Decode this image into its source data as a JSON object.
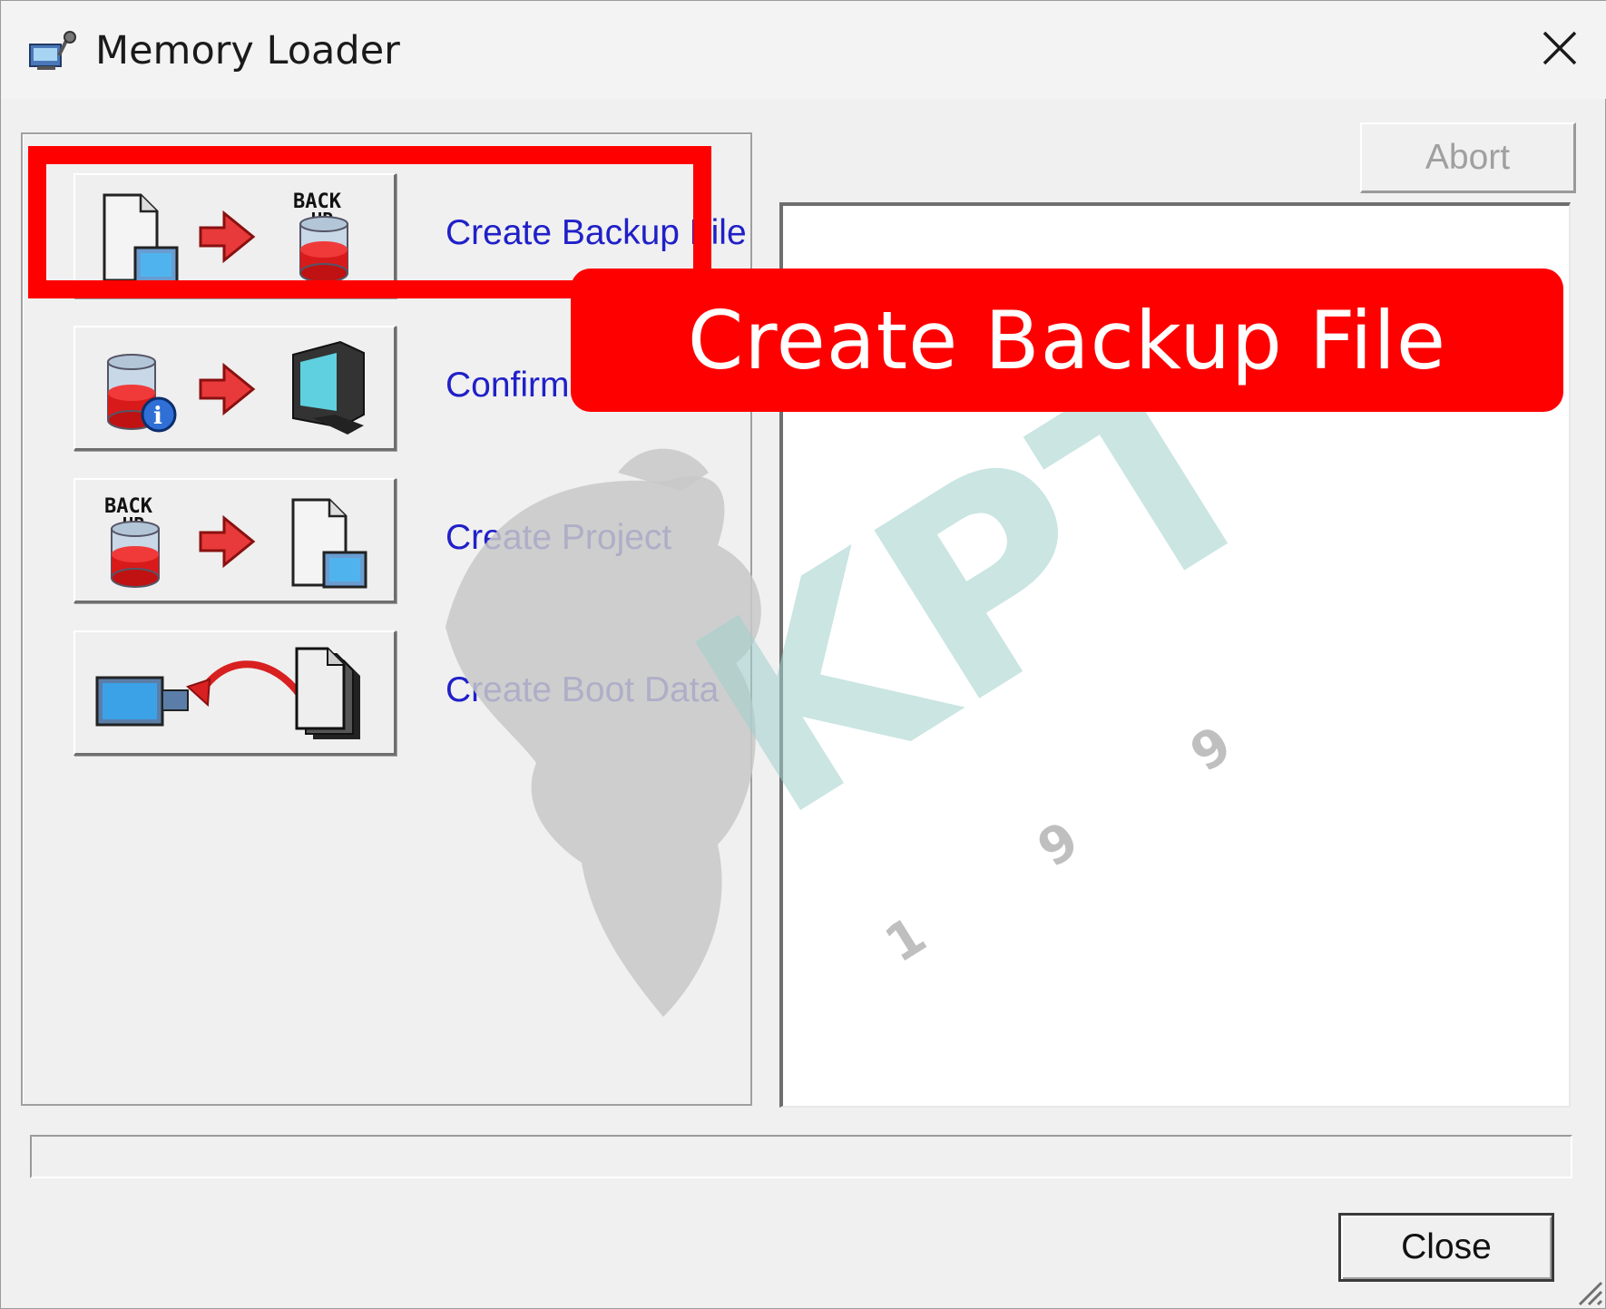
{
  "window": {
    "title": "Memory Loader",
    "app_icon": "memory-loader-icon",
    "close_icon": "close-icon"
  },
  "operations": [
    {
      "label": "Create Backup File",
      "icons": [
        "project-file-icon",
        "arrow-right-icon",
        "backup-cylinder-icon"
      ],
      "icon_text": [
        "BACK",
        "UP"
      ]
    },
    {
      "label": "Confirm Backup Data",
      "icons": [
        "database-info-icon",
        "arrow-right-icon",
        "monitor-icon"
      ]
    },
    {
      "label": "Create Project",
      "icons": [
        "backup-cylinder-icon",
        "arrow-right-icon",
        "project-file-icon"
      ],
      "icon_text": [
        "BACK",
        "UP"
      ]
    },
    {
      "label": "Create Boot Data",
      "icons": [
        "screen-icon",
        "curved-arrow-icon",
        "file-stack-icon"
      ]
    }
  ],
  "buttons": {
    "abort": "Abort",
    "close": "Close"
  },
  "log_output": "",
  "progress": 0,
  "annotation": {
    "callout_text": "Create Backup File",
    "color": "#ff0000"
  },
  "watermark": {
    "text": "KPT",
    "year": "1 9 9 3",
    "color": "#9fd0cc"
  },
  "colors": {
    "link_text": "#2020c8",
    "disabled_text": "#a0a0a0",
    "highlight": "#ff0000"
  }
}
